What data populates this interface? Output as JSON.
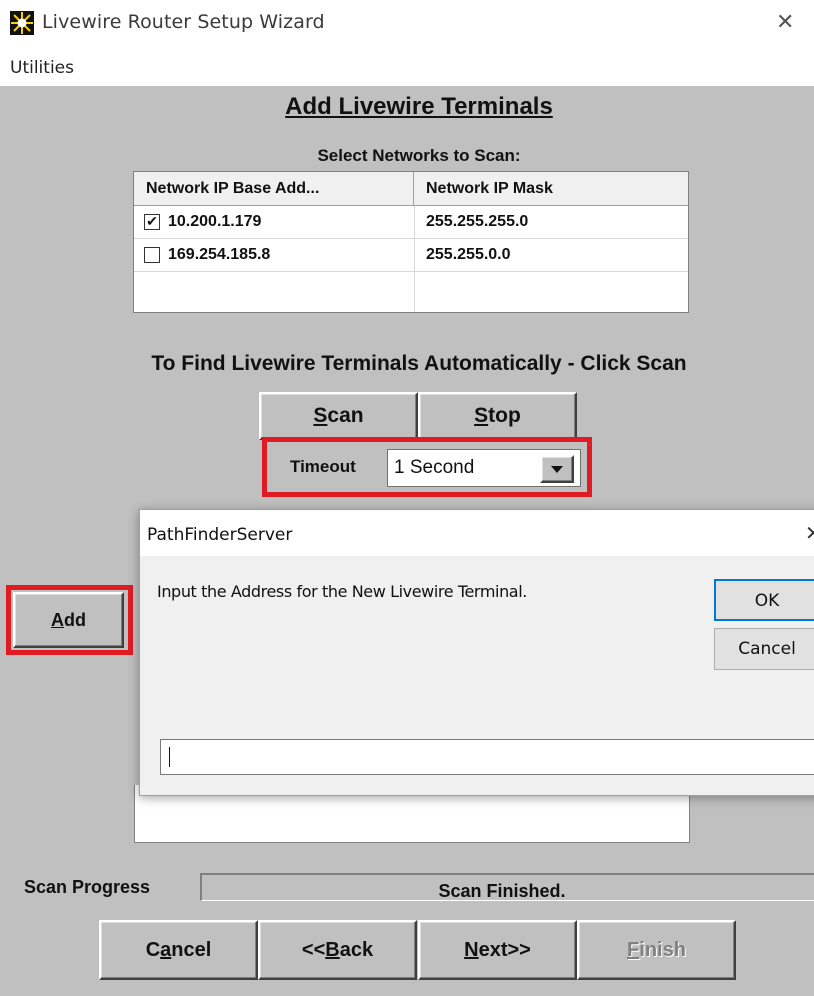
{
  "window": {
    "title": "Livewire Router Setup Wizard"
  },
  "menu": {
    "utilities": "Utilities"
  },
  "wizard": {
    "heading": "Add Livewire Terminals",
    "networks_label": "Select Networks to Scan:",
    "table": {
      "columns": [
        "Network IP Base Add...",
        "Network IP Mask"
      ],
      "rows": [
        {
          "checked": true,
          "ip": "10.200.1.179",
          "mask": "255.255.255.0"
        },
        {
          "checked": false,
          "ip": "169.254.185.8",
          "mask": "255.255.0.0"
        }
      ]
    },
    "auto_label": "To Find Livewire Terminals Automatically - Click Scan",
    "scan": {
      "hotkey": "S",
      "rest": "can"
    },
    "stop": {
      "hotkey": "S",
      "rest": "top"
    },
    "timeout": {
      "label": "Timeout",
      "value": "1 Second"
    },
    "add": {
      "hotkey": "A",
      "rest": "dd"
    },
    "progress": {
      "label": "Scan Progress",
      "status": "Scan Finished."
    },
    "nav": {
      "cancel": {
        "pre": "C",
        "hotkey": "a",
        "rest": "ncel"
      },
      "back": {
        "pre": "<<",
        "hotkey": "B",
        "rest": "ack"
      },
      "next": {
        "pre": "",
        "hotkey": "N",
        "rest": "ext>>"
      },
      "finish": {
        "pre": "",
        "hotkey": "F",
        "rest": "inish",
        "enabled": false
      }
    }
  },
  "dialog": {
    "title": "PathFinderServer",
    "prompt": "Input the Address for the New Livewire Terminal.",
    "ok": "OK",
    "cancel": "Cancel",
    "input_value": ""
  },
  "colors": {
    "wizard_bg": "#c0c0c0",
    "highlight": "#e01b24",
    "dialog_bg": "#f0f0f0"
  }
}
